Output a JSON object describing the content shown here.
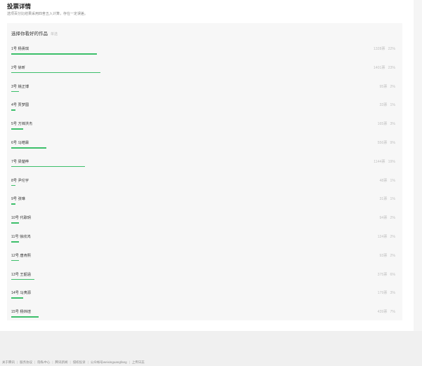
{
  "page": {
    "title": "投票详情",
    "subtitle": "选项百分比结果采用四舍五入计算，存在一定误差。"
  },
  "panel": {
    "heading": "选择你看好的作品",
    "mode_tag": "单选"
  },
  "options": [
    {
      "label": "1号 杨熹琪",
      "votes": "1328票",
      "percent": "22%",
      "fraction": 0.22
    },
    {
      "label": "2号 徐昕",
      "votes": "1401票",
      "percent": "23%",
      "fraction": 0.23
    },
    {
      "label": "3号 姚正博",
      "votes": "95票",
      "percent": "2%",
      "fraction": 0.02
    },
    {
      "label": "4号 贾梦圆",
      "votes": "33票",
      "percent": "1%",
      "fraction": 0.01
    },
    {
      "label": "5号 方锦洪杰",
      "votes": "165票",
      "percent": "3%",
      "fraction": 0.03
    },
    {
      "label": "6号 马皓霖",
      "votes": "556票",
      "percent": "9%",
      "fraction": 0.09
    },
    {
      "label": "7号 梁楚桦",
      "votes": "1144票",
      "percent": "19%",
      "fraction": 0.19
    },
    {
      "label": "8号 尹伦宇",
      "votes": "48票",
      "percent": "1%",
      "fraction": 0.01
    },
    {
      "label": "9号 张琳",
      "votes": "31票",
      "percent": "1%",
      "fraction": 0.01
    },
    {
      "label": "10号 代歌玥",
      "votes": "94票",
      "percent": "2%",
      "fraction": 0.02
    },
    {
      "label": "11号 徐欣鸿",
      "votes": "124票",
      "percent": "2%",
      "fraction": 0.02
    },
    {
      "label": "12号 唐肯熙",
      "votes": "93票",
      "percent": "2%",
      "fraction": 0.02
    },
    {
      "label": "13号 王韶涵",
      "votes": "375票",
      "percent": "6%",
      "fraction": 0.06
    },
    {
      "label": "14号 马夷源",
      "votes": "179票",
      "percent": "3%",
      "fraction": 0.03
    },
    {
      "label": "15号 杨炜煊",
      "votes": "439票",
      "percent": "7%",
      "fraction": 0.07
    }
  ],
  "footer": {
    "links": [
      "关于腾讯",
      "服务协议",
      "隐私中心",
      "腾讯新闻",
      "侵权投诉",
      "公众帐号weixinguangfang",
      "上传日志"
    ]
  },
  "colors": {
    "bar": "#3cbf6a",
    "panel_bg": "#f7f7f7"
  }
}
